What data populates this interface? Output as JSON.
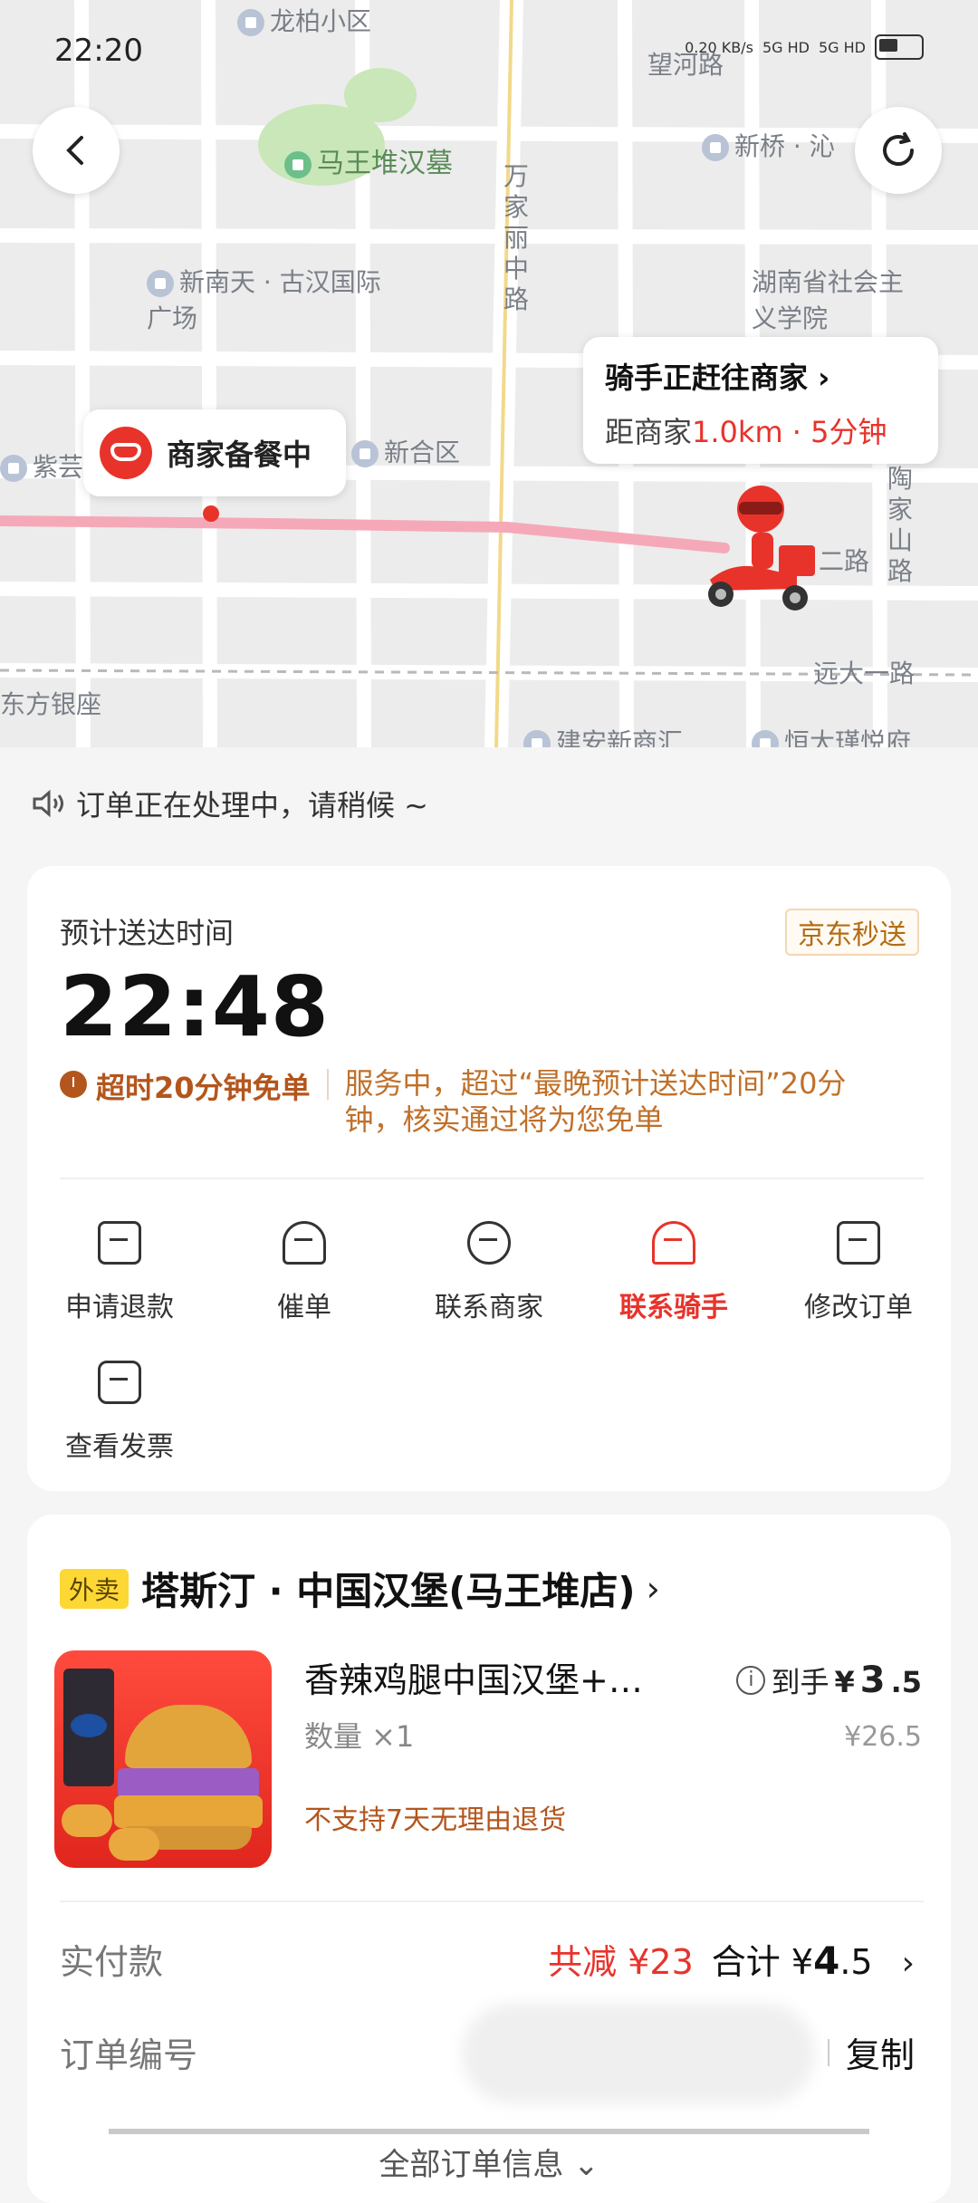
{
  "status_bar": {
    "time": "22:20",
    "net_speed": "0.20 KB/s",
    "sim1": "5G HD",
    "sim2": "5G HD"
  },
  "map": {
    "labels": {
      "longbai": "龙柏小区",
      "wanghe": "望河路",
      "mawangdui_tomb": "马王堆汉墓",
      "xinqiao": "新桥 · 沁",
      "wanjiali": "万家丽中路",
      "xinnantian": "新南天 · 古汉国际广场",
      "hunan_socialism": "湖南省社会主义学院",
      "ziyun": "紫芸",
      "xinhe": "新合区",
      "taojiashan": "陶家山路",
      "road2": "二路",
      "yuanda": "远大一路",
      "dongfang": "东方银座",
      "jianan": "建安新商汇",
      "hengda": "恒大瑾悦府"
    },
    "rider_bubble": {
      "title": "骑手正赶往商家",
      "distance_prefix": "距商家",
      "distance_value": "1.0km · 5分钟"
    },
    "merchant_bubble": {
      "text": "商家备餐中"
    }
  },
  "notice": "订单正在处理中，请稍候 ~",
  "delivery": {
    "eta_label": "预计送达时间",
    "service_tag": "京东秒送",
    "eta_time": "22:48",
    "promise_title": "超时20分钟免单",
    "promise_desc": "服务中，超过“最晚预计送达时间”20分钟，核实通过将为您免单",
    "actions": [
      {
        "label": "申请退款",
        "icon": "refund-icon"
      },
      {
        "label": "催单",
        "icon": "bell-icon"
      },
      {
        "label": "联系商家",
        "icon": "merchant-chat-icon"
      },
      {
        "label": "联系骑手",
        "icon": "rider-helmet-icon"
      },
      {
        "label": "修改订单",
        "icon": "edit-order-icon"
      },
      {
        "label": "查看发票",
        "icon": "invoice-icon"
      }
    ]
  },
  "order": {
    "type_tag": "外卖",
    "shop_name": "塔斯汀 · 中国汉堡(马王堆店)",
    "product": {
      "name": "香辣鸡腿中国汉堡+…",
      "qty": "数量 ×1",
      "price_prefix": "到手",
      "price_symbol": "¥",
      "price_int": "3",
      "price_dec": ".5",
      "orig_price": "¥26.5",
      "note": "不支持7天无理由退货"
    },
    "paid_label": "实付款",
    "discount": "共减 ¥23",
    "total_label": "合计",
    "total_symbol": "¥",
    "total_int": "4",
    "total_dec": ".5",
    "order_id_label": "订单编号",
    "copy_label": "复制",
    "all_info": "全部订单信息"
  },
  "colors": {
    "accent_red": "#e8332b",
    "promise_brown": "#b3561d",
    "tag_yellow": "#fdd835"
  }
}
